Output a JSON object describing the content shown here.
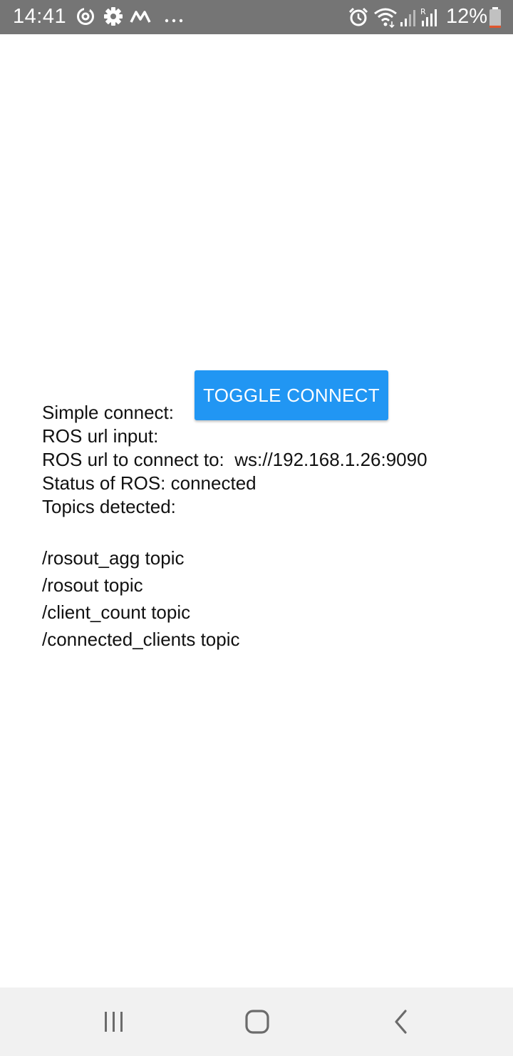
{
  "status_bar": {
    "time": "14:41",
    "battery_percent": "12%",
    "battery_level": 0.12,
    "icons": [
      "sync-icon",
      "settings-gear-icon",
      "m-app-icon",
      "more-dots-icon",
      "alarm-icon",
      "wifi-icon",
      "signal-icon",
      "signal-roaming-icon",
      "battery-icon"
    ]
  },
  "main": {
    "toggle_button_label": "TOGGLE CONNECT",
    "simple_connect_label": "Simple connect:",
    "ros_url_input_label": "ROS url input:",
    "ros_url_line": "ROS url to connect to:  ws://192.168.1.26:9090",
    "status_line": "Status of ROS: connected",
    "topics_label": "Topics detected:",
    "topics": [
      "/rosout_agg topic",
      "/rosout topic",
      "/client_count topic",
      "/connected_clients topic"
    ]
  },
  "nav_bar": {
    "icons": [
      "recent-apps-icon",
      "home-icon",
      "back-icon"
    ]
  },
  "colors": {
    "status_bar_bg": "#757575",
    "button_bg": "#2196F3",
    "nav_bar_bg": "#f1f1f1",
    "battery_low": "#e0552d"
  }
}
